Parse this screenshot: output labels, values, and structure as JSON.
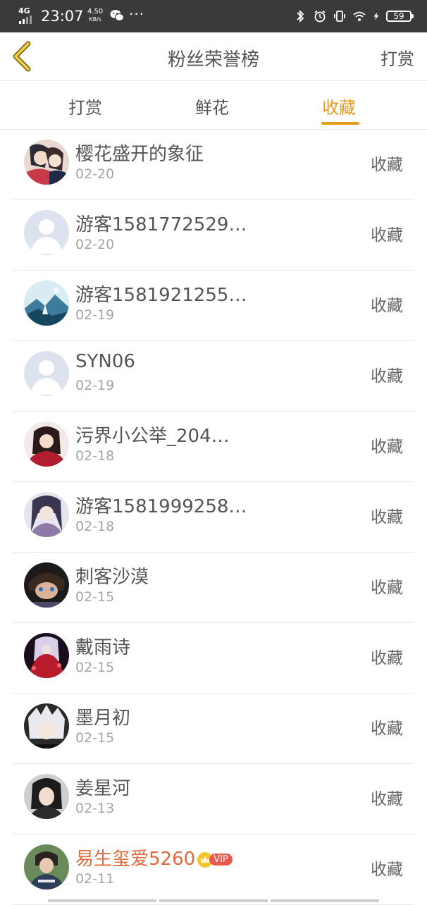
{
  "status_bar": {
    "network": "4G",
    "time": "23:07",
    "speed_value": "4.50",
    "speed_unit": "KB/s",
    "more": "···",
    "battery": "59"
  },
  "header": {
    "title": "粉丝荣誉榜",
    "action": "打赏"
  },
  "tabs": [
    {
      "label": "打赏",
      "active": false
    },
    {
      "label": "鲜花",
      "active": false
    },
    {
      "label": "收藏",
      "active": true
    }
  ],
  "colors": {
    "accent": "#e99b1a",
    "vip_name": "#e06b3d",
    "vip_badge": "#e8584d"
  },
  "items": [
    {
      "name": "樱花盛开的象征",
      "date": "02-20",
      "action": "收藏",
      "avatar": "anime-couple"
    },
    {
      "name": "游客1581772529…",
      "date": "02-20",
      "action": "收藏",
      "avatar": "default-user"
    },
    {
      "name": "游客1581921255…",
      "date": "02-19",
      "action": "收藏",
      "avatar": "landscape"
    },
    {
      "name": "SYN06",
      "date": "02-19",
      "action": "收藏",
      "avatar": "default-user"
    },
    {
      "name": "污界小公举_204…",
      "date": "02-18",
      "action": "收藏",
      "avatar": "girl-red"
    },
    {
      "name": "游客1581999258…",
      "date": "02-18",
      "action": "收藏",
      "avatar": "anime-boy"
    },
    {
      "name": "刺客沙漠",
      "date": "02-15",
      "action": "收藏",
      "avatar": "anime-dark"
    },
    {
      "name": "戴雨诗",
      "date": "02-15",
      "action": "收藏",
      "avatar": "anime-red"
    },
    {
      "name": "墨月初",
      "date": "02-15",
      "action": "收藏",
      "avatar": "anime-white-hair"
    },
    {
      "name": "姜星河",
      "date": "02-13",
      "action": "收藏",
      "avatar": "girl-photo"
    },
    {
      "name": "易生玺爱5260",
      "date": "02-11",
      "action": "收藏",
      "avatar": "boy-photo",
      "vip": true,
      "vip_label": "VIP"
    }
  ]
}
